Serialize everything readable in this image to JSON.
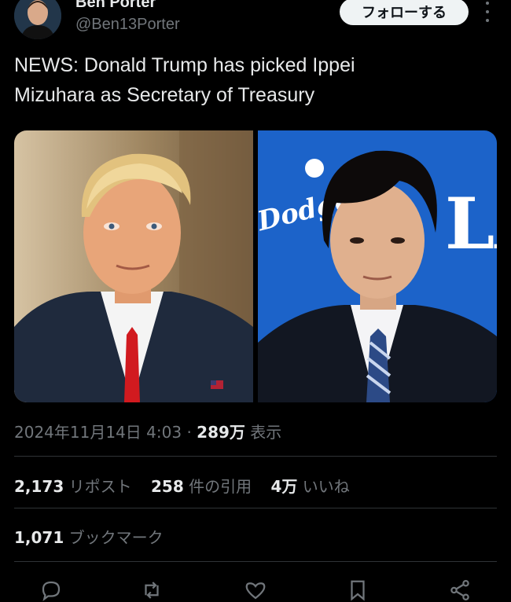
{
  "author": {
    "display_name": "Ben Porter",
    "handle": "@Ben13Porter",
    "avatar_icon": "avatar"
  },
  "follow_button": {
    "label": "フォローする"
  },
  "more_menu": {
    "icon": "more-vertical-icon"
  },
  "tweet": {
    "text_line1": "NEWS: Donald Trump has picked Ippei",
    "text_line2": "Mizuhara as Secretary of Treasury"
  },
  "media": {
    "photos": [
      {
        "label": "photo-1",
        "logo_text": ""
      },
      {
        "label": "photo-2",
        "logo_text_left": "Dodgers",
        "logo_text_right": "LA"
      }
    ]
  },
  "meta": {
    "timestamp": "2024年11月14日 4:03",
    "separator": "·",
    "views_count": "289万",
    "views_label": "表示"
  },
  "stats": {
    "reposts_count": "2,173",
    "reposts_label": "リポスト",
    "quotes_count": "258",
    "quotes_label": "件の引用",
    "likes_count": "4万",
    "likes_label": "いいね",
    "bookmarks_count": "1,071",
    "bookmarks_label": "ブックマーク"
  },
  "actions": [
    "reply-icon",
    "repost-icon",
    "like-icon",
    "bookmark-icon",
    "share-icon"
  ],
  "colors": {
    "background": "#000000",
    "text_primary": "#e7e9ea",
    "text_secondary": "#71767b",
    "divider": "#2f3336",
    "button_bg": "#eff3f4"
  }
}
